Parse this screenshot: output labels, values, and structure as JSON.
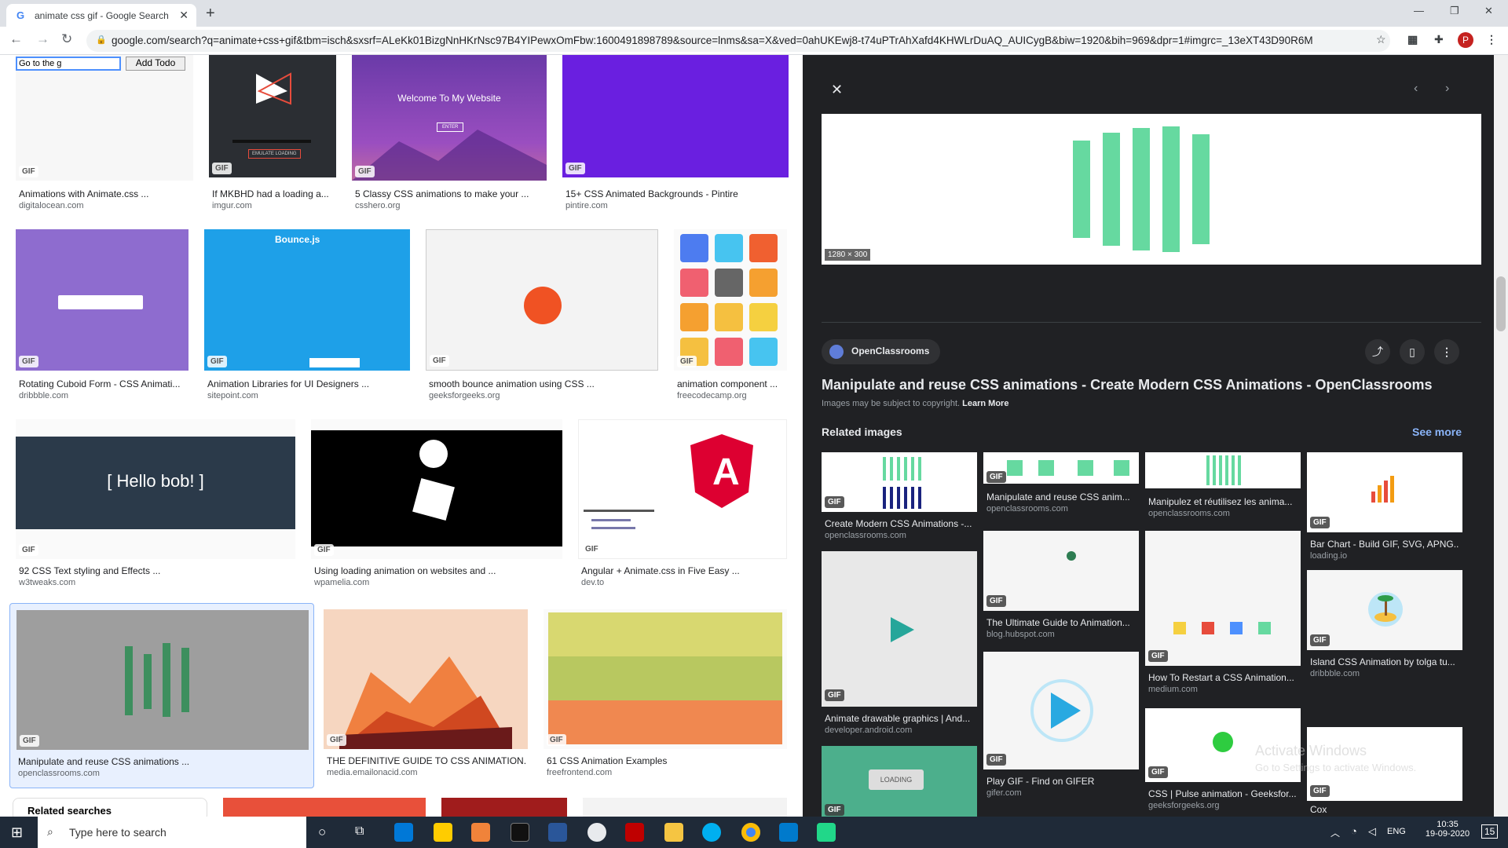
{
  "browser": {
    "tab_title": "animate css gif - Google Search",
    "url": "google.com/search?q=animate+css+gif&tbm=isch&sxsrf=ALeKk01BizgNnHKrNsc97B4YIPewxOmFbw:1600491898789&source=lnms&sa=X&ved=0ahUKEwj8-t74uPTrAhXafd4KHWLrDuAQ_AUICygB&biw=1920&bih=969&dpr=1#imgrc=_13eXT43D90R6M",
    "avatar": "P"
  },
  "results": [
    {
      "cap": "Animations with Animate.css ...",
      "dom": "digitalocean.com"
    },
    {
      "cap": "If MKBHD had a loading a...",
      "dom": "imgur.com"
    },
    {
      "cap": "5 Classy CSS animations to make your ...",
      "dom": "csshero.org"
    },
    {
      "cap": "15+ CSS Animated Backgrounds - Pintire",
      "dom": "pintire.com"
    },
    {
      "cap": "Rotating Cuboid Form - CSS Animati...",
      "dom": "dribbble.com"
    },
    {
      "cap": "Animation Libraries for UI Designers ...",
      "dom": "sitepoint.com"
    },
    {
      "cap": "smooth bounce animation using CSS ...",
      "dom": "geeksforgeeks.org"
    },
    {
      "cap": "animation component ...",
      "dom": "freecodecamp.org"
    },
    {
      "cap": "92 CSS Text styling and Effects ...",
      "dom": "w3tweaks.com"
    },
    {
      "cap": "Using loading animation on websites and ...",
      "dom": "wpamelia.com"
    },
    {
      "cap": "Angular + Animate.css in Five Easy ...",
      "dom": "dev.to"
    },
    {
      "cap": "Manipulate and reuse CSS animations ...",
      "dom": "openclassrooms.com"
    },
    {
      "cap": "THE DEFINITIVE GUIDE TO CSS ANIMATION...",
      "dom": "media.emailonacid.com"
    },
    {
      "cap": "61 CSS Animation Examples",
      "dom": "freefrontend.com"
    }
  ],
  "thumb_text": {
    "todo_input": "Go to the g",
    "todo_button": "Add Todo",
    "welcome": "Welcome To My Website",
    "enter": "ENTER",
    "bounce": "Bounce.js",
    "hello": "[ Hello  bob! ]",
    "loading": "LOADING",
    "emulate": "EMULATE LOADING",
    "related_searches": "Related searches"
  },
  "gif_label": "GIF",
  "panel": {
    "dims": "1280 × 300",
    "source": "OpenClassrooms",
    "title": "Manipulate and reuse CSS animations - Create Modern CSS Animations - OpenClassrooms",
    "copyright": "Images may be subject to copyright.",
    "learn_more": "Learn More",
    "related": "Related images",
    "see_more": "See more"
  },
  "related": [
    {
      "cap": "Create Modern CSS Animations -...",
      "dom": "openclassrooms.com"
    },
    {
      "cap": "Manipulate and reuse CSS anim...",
      "dom": "openclassrooms.com"
    },
    {
      "cap": "Manipulez et réutilisez les anima...",
      "dom": "openclassrooms.com"
    },
    {
      "cap": "Bar Chart - Build GIF, SVG, APNG...",
      "dom": "loading.io"
    },
    {
      "cap": "Animate drawable graphics | And...",
      "dom": "developer.android.com"
    },
    {
      "cap": "The Ultimate Guide to Animation...",
      "dom": "blog.hubspot.com"
    },
    {
      "cap": "How To Restart a CSS Animation...",
      "dom": "medium.com"
    },
    {
      "cap": "Island CSS Animation by tolga tu...",
      "dom": "dribbble.com"
    },
    {
      "cap": "Play GIF - Find on GIFER",
      "dom": "gifer.com"
    },
    {
      "cap": "CSS | Pulse animation - Geeksfor...",
      "dom": "geeksforgeeks.org"
    },
    {
      "cap": "Cox",
      "dom": ""
    }
  ],
  "watermark": {
    "line1": "Activate Windows",
    "line2": "Go to Settings to activate Windows."
  },
  "taskbar": {
    "search": "Type here to search",
    "lang": "ENG",
    "time": "10:35",
    "date": "19-09-2020",
    "notif": "15"
  }
}
